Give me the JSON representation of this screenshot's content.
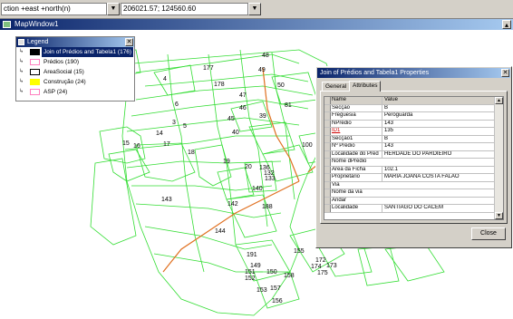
{
  "toolbar": {
    "layer_select": "ction +east +north(n)",
    "coordinates": "206021.57; 124560.60"
  },
  "map_window": {
    "title": "MapWindow1",
    "parcel_labels": [
      "48",
      "177",
      "4",
      "49",
      "178",
      "50",
      "47",
      "6",
      "46",
      "45",
      "40",
      "39",
      "14",
      "17",
      "18",
      "19",
      "20",
      "136",
      "132",
      "133",
      "140",
      "15",
      "16",
      "143",
      "142",
      "188",
      "144",
      "191",
      "149",
      "151",
      "152",
      "150",
      "153",
      "157",
      "156",
      "155",
      "158",
      "172",
      "173",
      "174",
      "175",
      "100",
      "81",
      "3",
      "5"
    ]
  },
  "legend": {
    "title": "Legend",
    "items": [
      {
        "label": "Join of Prédios and Tabela1 (176)",
        "color": "#000000",
        "selected": true
      },
      {
        "label": "Prédios (190)",
        "color": "#ff7fbf",
        "selected": false
      },
      {
        "label": "AreaSocial (15)",
        "color": "#ffffff",
        "selected": false
      },
      {
        "label": "Construção (24)",
        "color": "#ffff00",
        "selected": false
      },
      {
        "label": "ASP (24)",
        "color": "#ff7fbf",
        "selected": false
      }
    ]
  },
  "properties": {
    "title": "Join of Prédios and Tabela1 Properties",
    "tabs": [
      "General",
      "Attributes"
    ],
    "active_tab": "Attributes",
    "columns": [
      "Name",
      "Value"
    ],
    "rows": [
      {
        "name": "Secção",
        "value": "B"
      },
      {
        "name": "Freguesia",
        "value": "Peroguarda"
      },
      {
        "name": "NPrédio",
        "value": "143"
      },
      {
        "name": "ID1",
        "value": "135"
      },
      {
        "name": "Secção1",
        "value": "B"
      },
      {
        "name": "Nº Prédio",
        "value": "143"
      },
      {
        "name": "Localidade do Prédio",
        "value": "HERDADE DO PARDIEIRO"
      },
      {
        "name": "Nome dPrédio",
        "value": ""
      },
      {
        "name": "Area da Ficha",
        "value": "102.1"
      },
      {
        "name": "Proprietário",
        "value": "MARIA JOANA COSTA FALÃO"
      },
      {
        "name": "Via",
        "value": ""
      },
      {
        "name": "Nome da via",
        "value": ""
      },
      {
        "name": "Andar",
        "value": ""
      },
      {
        "name": "Localidade",
        "value": "SANTIAGO DO CACÉM"
      }
    ],
    "close_label": "Close"
  },
  "colors": {
    "parcel_lines": "#33dd33",
    "road_lines": "#e07020",
    "title_bar": "#0a246a"
  }
}
